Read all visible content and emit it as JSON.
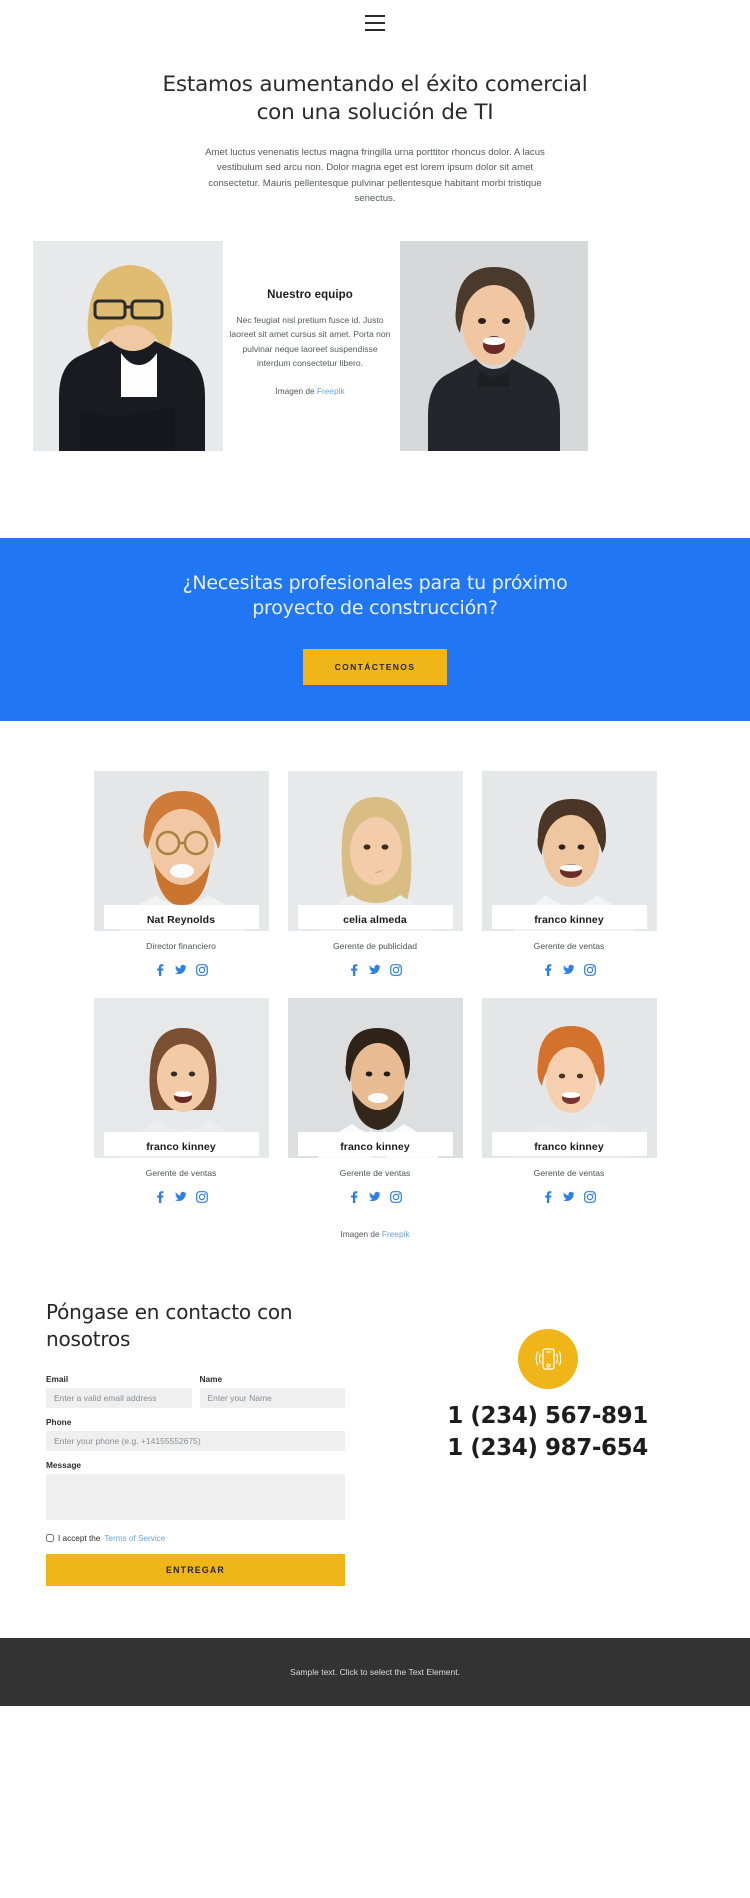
{
  "header": {
    "menu_icon": "hamburger-menu-icon"
  },
  "hero": {
    "title": "Estamos aumentando el éxito comercial con una solución de TI",
    "paragraph": "Amet luctus venenatis lectus magna fringilla urna porttitor rhoncus dolor. A lacus vestibulum sed arcu non. Dolor magna eget est lorem ipsum dolor sit amet consectetur. Mauris pellentesque pulvinar pellentesque habitant morbi tristique senectus."
  },
  "about": {
    "heading": "Nuestro equipo",
    "paragraph": "Nec feugiat nisl pretium fusce id. Justo laoreet sit amet cursus sit amet. Porta non pulvinar neque laoreet suspendisse interdum consectetur libero.",
    "credit_prefix": "Imagen de ",
    "credit_link": "Freepik",
    "left_photo_alt": "businesswoman-portrait",
    "right_photo_alt": "young-man-portrait"
  },
  "cta": {
    "title": "¿Necesitas profesionales para tu próximo proyecto de construcción?",
    "button_label": "CONTÁCTENOS",
    "background_color": "#2176f3",
    "button_color": "#f0b619"
  },
  "team": {
    "social_icons": [
      "facebook-icon",
      "twitter-icon",
      "instagram-icon"
    ],
    "members": [
      {
        "name": "Nat Reynolds",
        "role": "Director financiero"
      },
      {
        "name": "celia almeda",
        "role": "Gerente de publicidad"
      },
      {
        "name": "franco kinney",
        "role": "Gerente de ventas"
      },
      {
        "name": "franco kinney",
        "role": "Gerente de ventas"
      },
      {
        "name": "franco kinney",
        "role": "Gerente de ventas"
      },
      {
        "name": "franco kinney",
        "role": "Gerente de ventas"
      }
    ],
    "credit_prefix": "Imagen de ",
    "credit_link": "Freepik"
  },
  "contact": {
    "title": "Póngase en contacto con nosotros",
    "fields": {
      "email_label": "Email",
      "email_placeholder": "Enter a valid email address",
      "email_value": "",
      "name_label": "Name",
      "name_placeholder": "Enter your Name",
      "name_value": "",
      "phone_label": "Phone",
      "phone_placeholder": "Enter your phone (e.g. +14155552675)",
      "phone_value": "",
      "message_label": "Message",
      "message_placeholder": "",
      "message_value": ""
    },
    "accept_text": "I accept the ",
    "terms_link": "Terms of Service",
    "submit_label": "ENTREGAR",
    "phone_icon": "mobile-phone-ringing-icon",
    "phone_numbers": [
      "1 (234) 567-891",
      "1 (234) 987-654"
    ],
    "accent_color": "#f0b619"
  },
  "footer": {
    "text": "Sample text. Click to select the Text Element."
  }
}
